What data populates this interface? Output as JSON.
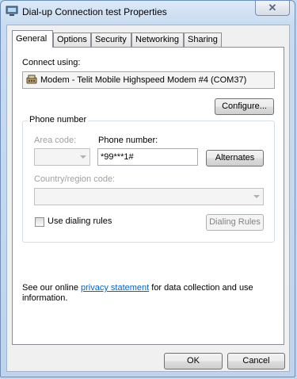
{
  "window": {
    "title": "Dial-up Connection test Properties",
    "close_glyph": "✕"
  },
  "tabs": [
    {
      "label": "General",
      "active": true
    },
    {
      "label": "Options"
    },
    {
      "label": "Security"
    },
    {
      "label": "Networking"
    },
    {
      "label": "Sharing"
    }
  ],
  "general": {
    "connect_using_label": "Connect using:",
    "device": "Modem - Telit Mobile Highspeed Modem #4 (COM37)",
    "configure_button": "Configure...",
    "phone_group_label": "Phone number",
    "area_code_label": "Area code:",
    "area_code_value": "",
    "phone_number_label": "Phone number:",
    "phone_number_value": "*99***1#",
    "alternates_button": "Alternates",
    "country_label": "Country/region code:",
    "country_value": "",
    "use_dialing_rules_label": "Use dialing rules",
    "use_dialing_rules_checked": false,
    "dialing_rules_button": "Dialing Rules",
    "privacy_pre": "See our online ",
    "privacy_link": "privacy statement",
    "privacy_post": " for data collection and use information."
  },
  "footer": {
    "ok_button": "OK",
    "cancel_button": "Cancel"
  }
}
